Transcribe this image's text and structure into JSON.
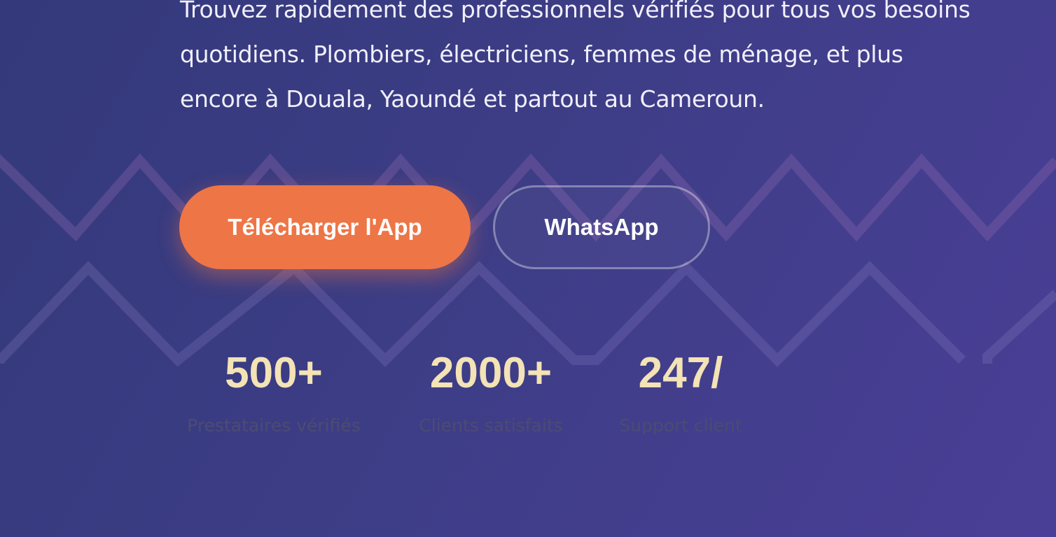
{
  "hero": {
    "description": "Trouvez rapidement des professionnels vérifiés pour tous vos besoins quotidiens. Plombiers, électriciens, femmes de ménage, et plus encore à Douala, Yaoundé et partout au Cameroun."
  },
  "buttons": {
    "download_label": "Télécharger l'App",
    "whatsapp_label": "WhatsApp"
  },
  "stats": [
    {
      "value": "500+",
      "label": "Prestataires vérifiés"
    },
    {
      "value": "2000+",
      "label": "Clients satisfaits"
    },
    {
      "value": "247/",
      "label": "Support client"
    }
  ],
  "colors": {
    "background_start": "#33397a",
    "background_end": "#4a3f96",
    "primary_button": "#ee7546",
    "stat_value": "#f3e3b5",
    "stat_label": "#4c4b73",
    "text": "#f1effa"
  }
}
